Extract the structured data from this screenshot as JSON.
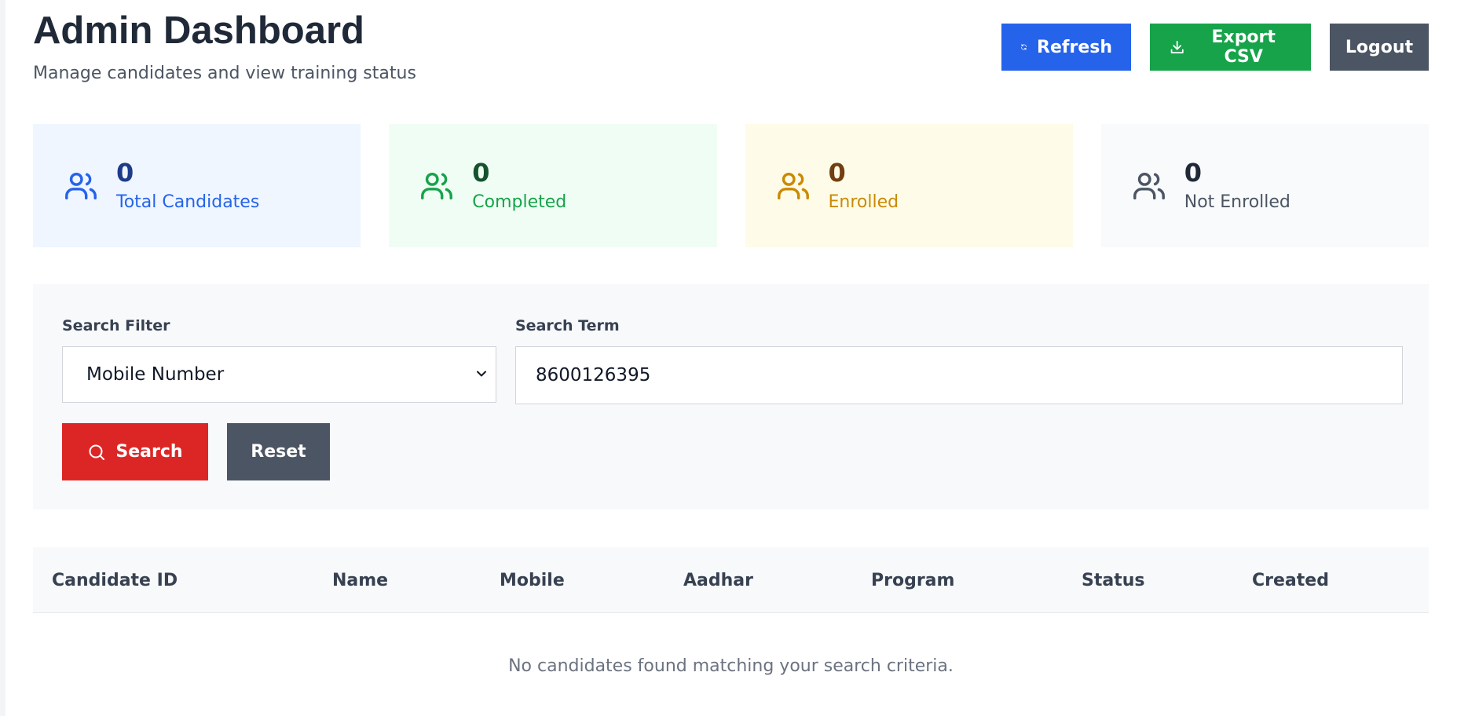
{
  "header": {
    "title": "Admin Dashboard",
    "subtitle": "Manage candidates and view training status",
    "refresh_label": "Refresh",
    "export_label": "Export CSV",
    "logout_label": "Logout"
  },
  "stats": [
    {
      "value": "0",
      "label": "Total Candidates",
      "icon": "users-icon",
      "color": "#2563eb"
    },
    {
      "value": "0",
      "label": "Completed",
      "icon": "users-icon",
      "color": "#16a34a"
    },
    {
      "value": "0",
      "label": "Enrolled",
      "icon": "users-icon",
      "color": "#ca8a04"
    },
    {
      "value": "0",
      "label": "Not Enrolled",
      "icon": "users-icon",
      "color": "#4b5563"
    }
  ],
  "filters": {
    "filter_label": "Search Filter",
    "filter_value": "Mobile Number",
    "term_label": "Search Term",
    "term_value": "8600126395",
    "search_label": "Search",
    "reset_label": "Reset"
  },
  "table": {
    "columns": [
      "Candidate ID",
      "Name",
      "Mobile",
      "Aadhar",
      "Program",
      "Status",
      "Created"
    ],
    "empty_message": "No candidates found matching your search criteria."
  }
}
